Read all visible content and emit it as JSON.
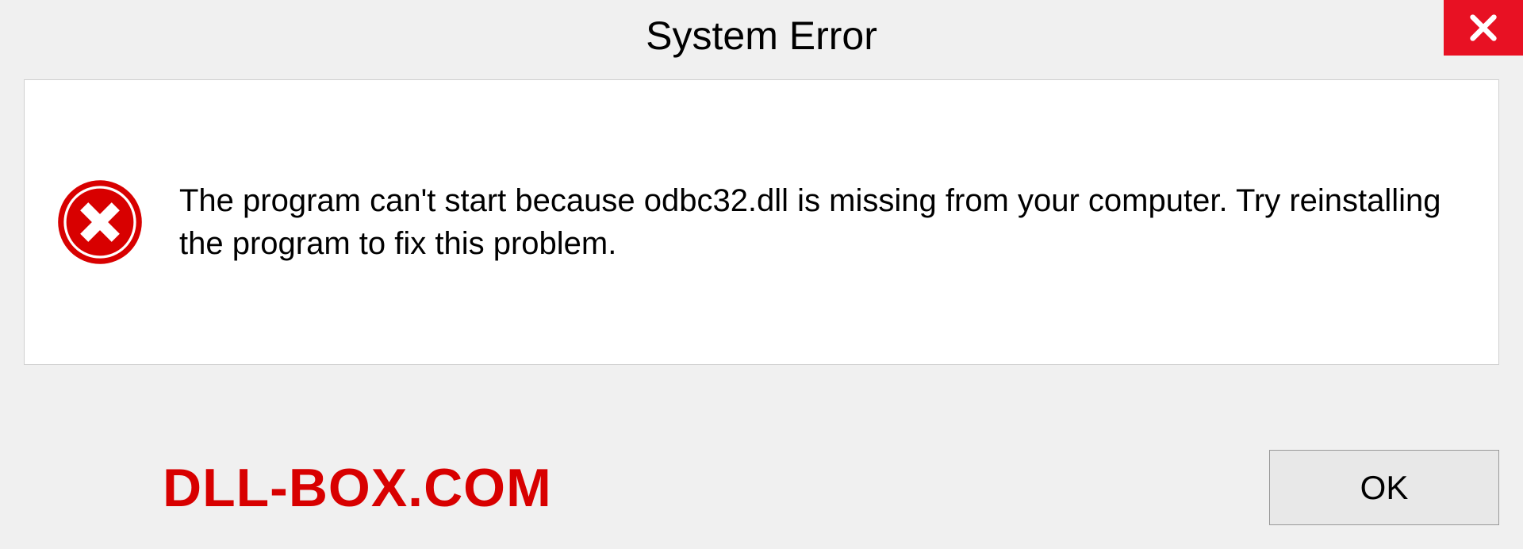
{
  "dialog": {
    "title": "System Error",
    "message": "The program can't start because odbc32.dll is missing from your computer. Try reinstalling the program to fix this problem.",
    "ok_label": "OK"
  },
  "watermark": "DLL-BOX.COM",
  "colors": {
    "close_bg": "#e81123",
    "error_red": "#d80000"
  }
}
